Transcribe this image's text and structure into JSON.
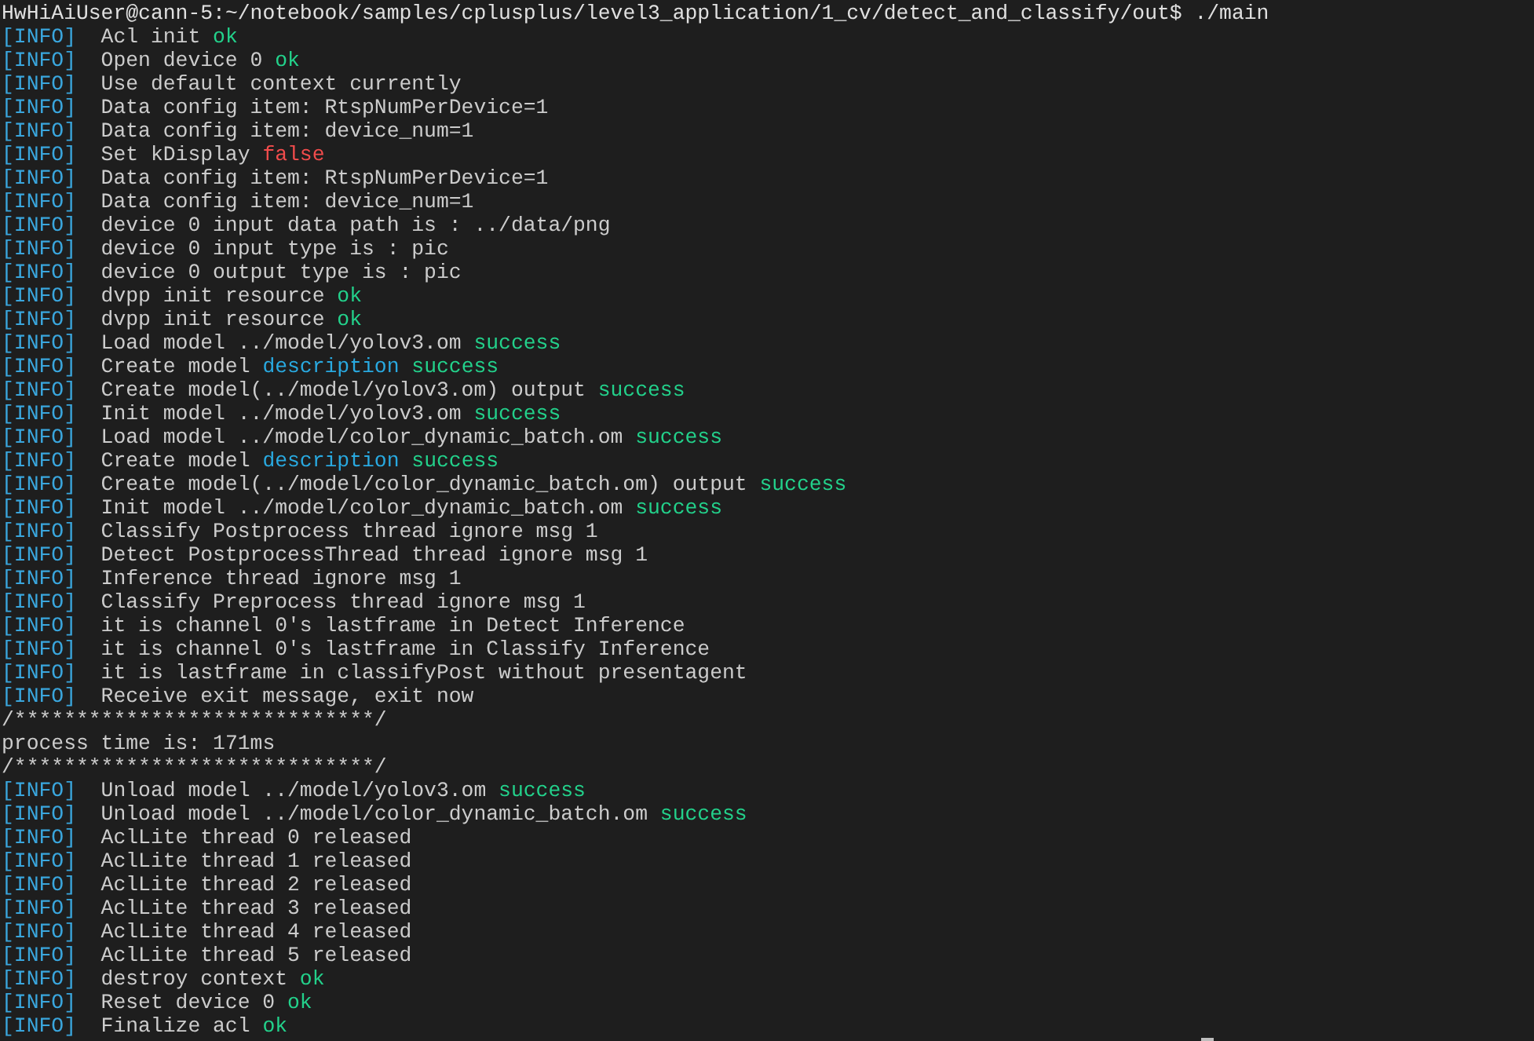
{
  "terminal": {
    "lines": [
      {
        "kind": "prompt",
        "parts": [
          {
            "text": "HwHiAiUser@cann-5:~/notebook/samples/cplusplus/level3_application/1_cv/detect_and_classify/out$ ./main"
          }
        ]
      },
      {
        "kind": "log",
        "tag": "[INFO]",
        "parts": [
          {
            "text": "Acl init "
          },
          {
            "text": "ok",
            "color": "#23d18b"
          }
        ]
      },
      {
        "kind": "log",
        "tag": "[INFO]",
        "parts": [
          {
            "text": "Open device 0 "
          },
          {
            "text": "ok",
            "color": "#23d18b"
          }
        ]
      },
      {
        "kind": "log",
        "tag": "[INFO]",
        "parts": [
          {
            "text": "Use default context currently"
          }
        ]
      },
      {
        "kind": "log",
        "tag": "[INFO]",
        "parts": [
          {
            "text": "Data config item: RtspNumPerDevice=1"
          }
        ]
      },
      {
        "kind": "log",
        "tag": "[INFO]",
        "parts": [
          {
            "text": "Data config item: device_num=1"
          }
        ]
      },
      {
        "kind": "log",
        "tag": "[INFO]",
        "parts": [
          {
            "text": "Set kDisplay "
          },
          {
            "text": "false",
            "color": "#f14c4c"
          }
        ]
      },
      {
        "kind": "log",
        "tag": "[INFO]",
        "parts": [
          {
            "text": "Data config item: RtspNumPerDevice=1"
          }
        ]
      },
      {
        "kind": "log",
        "tag": "[INFO]",
        "parts": [
          {
            "text": "Data config item: device_num=1"
          }
        ]
      },
      {
        "kind": "log",
        "tag": "[INFO]",
        "parts": [
          {
            "text": "device 0 input data path is : ../data/png"
          }
        ]
      },
      {
        "kind": "log",
        "tag": "[INFO]",
        "parts": [
          {
            "text": "device 0 input type is : pic"
          }
        ]
      },
      {
        "kind": "log",
        "tag": "[INFO]",
        "parts": [
          {
            "text": "device 0 output type is : pic"
          }
        ]
      },
      {
        "kind": "log",
        "tag": "[INFO]",
        "parts": [
          {
            "text": "dvpp init resource "
          },
          {
            "text": "ok",
            "color": "#23d18b"
          }
        ]
      },
      {
        "kind": "log",
        "tag": "[INFO]",
        "parts": [
          {
            "text": "dvpp init resource "
          },
          {
            "text": "ok",
            "color": "#23d18b"
          }
        ]
      },
      {
        "kind": "log",
        "tag": "[INFO]",
        "parts": [
          {
            "text": "Load model ../model/yolov3.om "
          },
          {
            "text": "success",
            "color": "#23d18b"
          }
        ]
      },
      {
        "kind": "log",
        "tag": "[INFO]",
        "parts": [
          {
            "text": "Create model "
          },
          {
            "text": "description",
            "color": "#29a9e0"
          },
          {
            "text": " success",
            "color": "#23d18b"
          }
        ]
      },
      {
        "kind": "log",
        "tag": "[INFO]",
        "parts": [
          {
            "text": "Create model(../model/yolov3.om) output "
          },
          {
            "text": "success",
            "color": "#23d18b"
          }
        ]
      },
      {
        "kind": "log",
        "tag": "[INFO]",
        "parts": [
          {
            "text": "Init model ../model/yolov3.om "
          },
          {
            "text": "success",
            "color": "#23d18b"
          }
        ]
      },
      {
        "kind": "log",
        "tag": "[INFO]",
        "parts": [
          {
            "text": "Load model ../model/color_dynamic_batch.om "
          },
          {
            "text": "success",
            "color": "#23d18b"
          }
        ]
      },
      {
        "kind": "log",
        "tag": "[INFO]",
        "parts": [
          {
            "text": "Create model "
          },
          {
            "text": "description",
            "color": "#29a9e0"
          },
          {
            "text": " success",
            "color": "#23d18b"
          }
        ]
      },
      {
        "kind": "log",
        "tag": "[INFO]",
        "parts": [
          {
            "text": "Create model(../model/color_dynamic_batch.om) output "
          },
          {
            "text": "success",
            "color": "#23d18b"
          }
        ]
      },
      {
        "kind": "log",
        "tag": "[INFO]",
        "parts": [
          {
            "text": "Init model ../model/color_dynamic_batch.om "
          },
          {
            "text": "success",
            "color": "#23d18b"
          }
        ]
      },
      {
        "kind": "log",
        "tag": "[INFO]",
        "parts": [
          {
            "text": "Classify Postprocess thread ignore msg 1"
          }
        ]
      },
      {
        "kind": "log",
        "tag": "[INFO]",
        "parts": [
          {
            "text": "Detect PostprocessThread thread ignore msg 1"
          }
        ]
      },
      {
        "kind": "log",
        "tag": "[INFO]",
        "parts": [
          {
            "text": "Inference thread ignore msg 1"
          }
        ]
      },
      {
        "kind": "log",
        "tag": "[INFO]",
        "parts": [
          {
            "text": "Classify Preprocess thread ignore msg 1"
          }
        ]
      },
      {
        "kind": "log",
        "tag": "[INFO]",
        "parts": [
          {
            "text": "it is channel 0's lastframe in Detect Inference"
          }
        ]
      },
      {
        "kind": "log",
        "tag": "[INFO]",
        "parts": [
          {
            "text": "it is channel 0's lastframe in Classify Inference"
          }
        ]
      },
      {
        "kind": "log",
        "tag": "[INFO]",
        "parts": [
          {
            "text": "it is lastframe in classifyPost without presentagent"
          }
        ]
      },
      {
        "kind": "log",
        "tag": "[INFO]",
        "parts": [
          {
            "text": "Receive exit message, exit now"
          }
        ]
      },
      {
        "kind": "output",
        "parts": [
          {
            "text": "/*****************************/"
          }
        ]
      },
      {
        "kind": "output",
        "parts": [
          {
            "text": "process time is: 171ms"
          }
        ]
      },
      {
        "kind": "output",
        "parts": [
          {
            "text": "/*****************************/"
          }
        ]
      },
      {
        "kind": "log",
        "tag": "[INFO]",
        "parts": [
          {
            "text": "Unload model ../model/yolov3.om "
          },
          {
            "text": "success",
            "color": "#23d18b"
          }
        ]
      },
      {
        "kind": "log",
        "tag": "[INFO]",
        "parts": [
          {
            "text": "Unload model ../model/color_dynamic_batch.om "
          },
          {
            "text": "success",
            "color": "#23d18b"
          }
        ]
      },
      {
        "kind": "log",
        "tag": "[INFO]",
        "parts": [
          {
            "text": "AclLite thread 0 released"
          }
        ]
      },
      {
        "kind": "log",
        "tag": "[INFO]",
        "parts": [
          {
            "text": "AclLite thread 1 released"
          }
        ]
      },
      {
        "kind": "log",
        "tag": "[INFO]",
        "parts": [
          {
            "text": "AclLite thread 2 released"
          }
        ]
      },
      {
        "kind": "log",
        "tag": "[INFO]",
        "parts": [
          {
            "text": "AclLite thread 3 released"
          }
        ]
      },
      {
        "kind": "log",
        "tag": "[INFO]",
        "parts": [
          {
            "text": "AclLite thread 4 released"
          }
        ]
      },
      {
        "kind": "log",
        "tag": "[INFO]",
        "parts": [
          {
            "text": "AclLite thread 5 released"
          }
        ]
      },
      {
        "kind": "log",
        "tag": "[INFO]",
        "parts": [
          {
            "text": "destroy context "
          },
          {
            "text": "ok",
            "color": "#23d18b"
          }
        ]
      },
      {
        "kind": "log",
        "tag": "[INFO]",
        "parts": [
          {
            "text": "Reset device 0 "
          },
          {
            "text": "ok",
            "color": "#23d18b"
          }
        ]
      },
      {
        "kind": "log",
        "tag": "[INFO]",
        "parts": [
          {
            "text": "Finalize acl "
          },
          {
            "text": "ok",
            "color": "#23d18b"
          }
        ]
      }
    ]
  }
}
